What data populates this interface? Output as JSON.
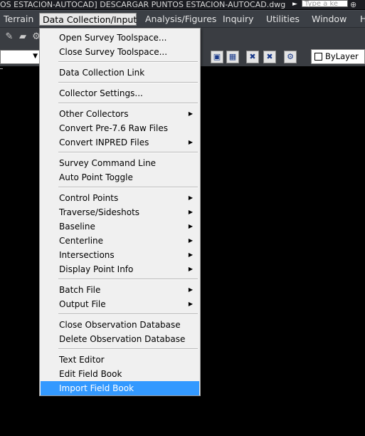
{
  "titlebar": {
    "title": "OS ESTACION-AUTOCAD] DESCARGAR PUNTOS ESTACION-AUTOCAD.dwg",
    "search_placeholder": "Type a ke"
  },
  "menubar": {
    "items": [
      {
        "label": "Terrain"
      },
      {
        "label": "Data Collection/Input"
      },
      {
        "label": "Analysis/Figures"
      },
      {
        "label": "Inquiry"
      },
      {
        "label": "Utilities"
      },
      {
        "label": "Window"
      },
      {
        "label": "H"
      }
    ]
  },
  "toolbar": {
    "layer_combo": "ByLayer"
  },
  "dropdown": {
    "items": [
      {
        "label": "Open Survey Toolspace..."
      },
      {
        "label": "Close Survey Toolspace..."
      },
      {
        "label": "Data Collection Link"
      },
      {
        "label": "Collector Settings..."
      },
      {
        "label": "Other Collectors"
      },
      {
        "label": "Convert Pre-7.6 Raw Files"
      },
      {
        "label": "Convert INPRED Files"
      },
      {
        "label": "Survey Command Line"
      },
      {
        "label": "Auto Point Toggle"
      },
      {
        "label": "Control Points"
      },
      {
        "label": "Traverse/Sideshots"
      },
      {
        "label": "Baseline"
      },
      {
        "label": "Centerline"
      },
      {
        "label": "Intersections"
      },
      {
        "label": "Display Point Info"
      },
      {
        "label": "Batch File"
      },
      {
        "label": "Output File"
      },
      {
        "label": "Close Observation Database"
      },
      {
        "label": "Delete Observation Database"
      },
      {
        "label": "Text Editor"
      },
      {
        "label": "Edit Field Book"
      },
      {
        "label": "Import Field Book"
      }
    ],
    "highlighted": "Import Field Book"
  }
}
